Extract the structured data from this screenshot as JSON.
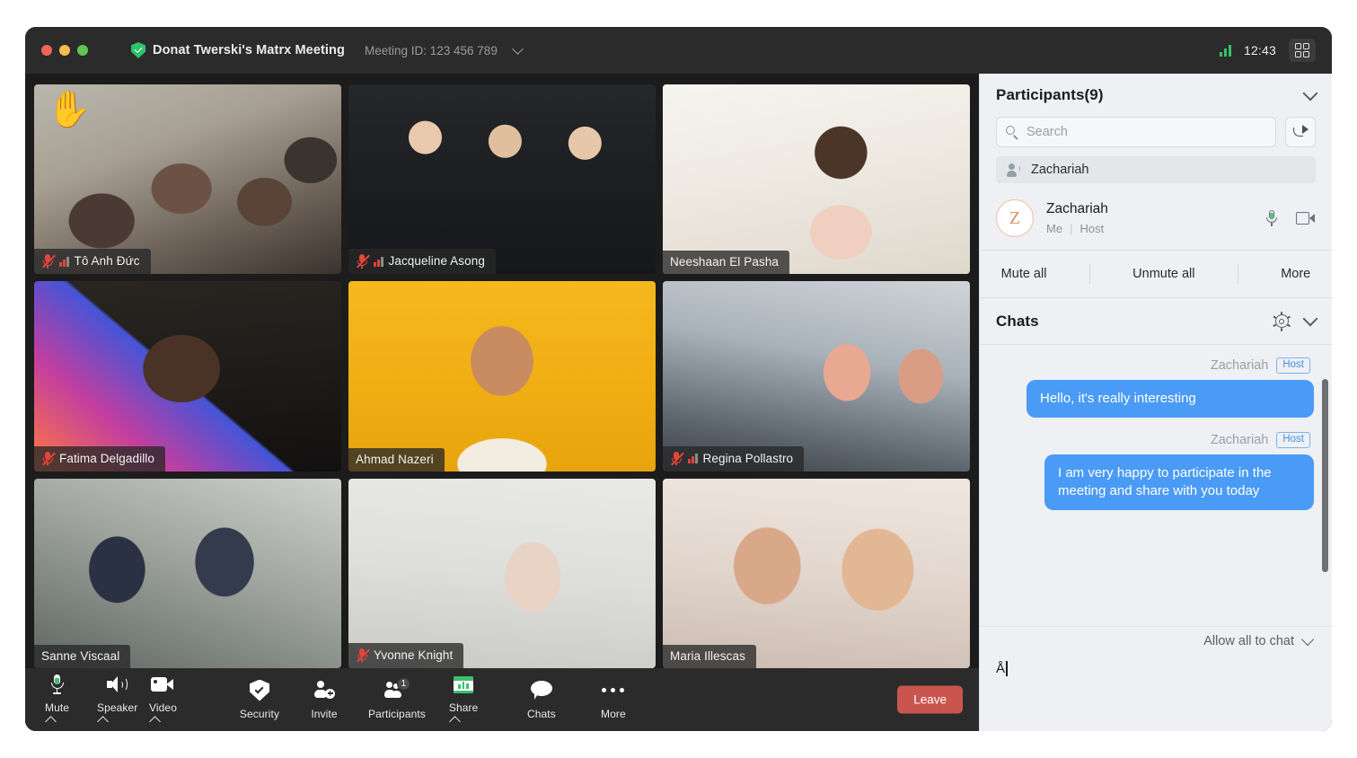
{
  "titlebar": {
    "meeting_title": "Donat Twerski's Matrx Meeting",
    "meeting_id": "Meeting ID: 123 456 789",
    "clock": "12:43",
    "shield_icon": "verified-shield-icon",
    "signal_icon": "signal-strength-icon",
    "layout_icon": "grid-view-icon",
    "chevron_icon": "chevron-down-icon"
  },
  "stage": {
    "tiles": [
      {
        "name": "Tô Anh Đức",
        "muted": true,
        "signal": true,
        "active": false,
        "hand_raised": true,
        "scene": "sc-1"
      },
      {
        "name": "Jacqueline Asong",
        "muted": true,
        "signal": true,
        "active": false,
        "hand_raised": false,
        "scene": "sc-2"
      },
      {
        "name": "Neeshaan El Pasha",
        "muted": false,
        "signal": false,
        "active": true,
        "hand_raised": false,
        "scene": "sc-3"
      },
      {
        "name": "Fatima Delgadillo",
        "muted": true,
        "signal": false,
        "active": false,
        "hand_raised": false,
        "scene": "sc-4"
      },
      {
        "name": "Ahmad Nazeri",
        "muted": false,
        "signal": false,
        "active": false,
        "hand_raised": false,
        "scene": "sc-5"
      },
      {
        "name": "Regina Pollastro",
        "muted": true,
        "signal": true,
        "active": false,
        "hand_raised": false,
        "scene": "sc-6"
      },
      {
        "name": "Sanne Viscaal",
        "muted": false,
        "signal": false,
        "active": false,
        "hand_raised": false,
        "scene": "sc-7"
      },
      {
        "name": "Yvonne Knight",
        "muted": true,
        "signal": false,
        "active": false,
        "hand_raised": false,
        "scene": "sc-8"
      },
      {
        "name": "Maria Illescas",
        "muted": false,
        "signal": false,
        "active": false,
        "hand_raised": false,
        "scene": "sc-9"
      }
    ],
    "hand_emoji": "✋"
  },
  "toolbar": {
    "mute_label": "Mute",
    "speaker_label": "Speaker",
    "video_label": "Video",
    "security_label": "Security",
    "invite_label": "Invite",
    "participants_label": "Participants",
    "participants_badge": "1",
    "share_label": "Share",
    "chats_label": "Chats",
    "more_label": "More",
    "leave_label": "Leave",
    "leave_color": "#c9554e",
    "accent_green": "#3dc06c"
  },
  "participants_panel": {
    "title": "Participants(9)",
    "collapse_icon": "chevron-down-icon",
    "search_placeholder": "Search",
    "search_value": "",
    "share_icon": "share-arrow-icon",
    "speaking_now": "Zachariah",
    "me": {
      "avatar_letter": "Z",
      "name": "Zachariah",
      "role_me": "Me",
      "role_host": "Host",
      "separator": "|"
    },
    "actions": {
      "mute_all": "Mute all",
      "unmute_all": "Unmute all",
      "more": "More"
    }
  },
  "chats_panel": {
    "title": "Chats",
    "settings_icon": "gear-icon",
    "collapse_icon": "chevron-down-icon",
    "messages": [
      {
        "author": "Zachariah",
        "badge": "Host",
        "text": "Hello, it's really interesting"
      },
      {
        "author": "Zachariah",
        "badge": "Host",
        "text": "I am very happy to participate in the meeting and share with you today"
      }
    ],
    "allow_label": "Allow all to chat",
    "compose_value": "Å",
    "bubble_color": "#4a9bf5"
  }
}
